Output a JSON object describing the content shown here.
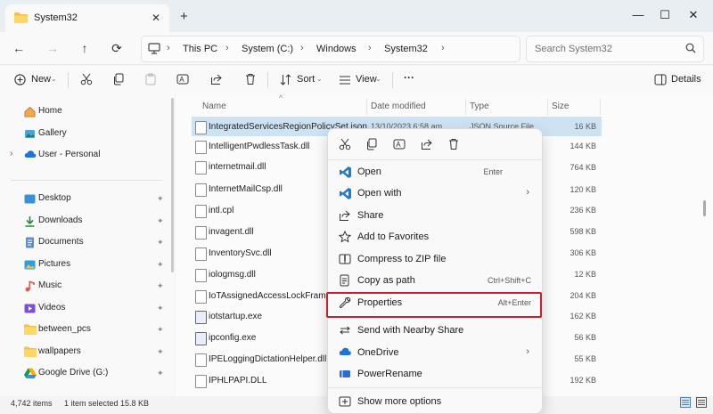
{
  "window": {
    "tab_title": "System32",
    "new_tab": "+",
    "minimize": "—",
    "maximize": "☐",
    "close": "✕"
  },
  "nav_buttons": {
    "back": "←",
    "forward": "→",
    "up": "↑",
    "refresh": "⟳"
  },
  "breadcrumb": [
    "This PC",
    "System (C:)",
    "Windows",
    "System32"
  ],
  "search": {
    "placeholder": "Search System32"
  },
  "commandbar": {
    "new_label": "New",
    "sort_label": "Sort",
    "view_label": "View",
    "more_label": "···",
    "details_label": "Details"
  },
  "sidebar": {
    "items": [
      {
        "label": "Home",
        "icon": "home-icon"
      },
      {
        "label": "Gallery",
        "icon": "gallery-icon"
      },
      {
        "label": "User - Personal",
        "icon": "cloud-icon"
      },
      {
        "label": "Desktop",
        "icon": "desktop-icon"
      },
      {
        "label": "Downloads",
        "icon": "download-icon"
      },
      {
        "label": "Documents",
        "icon": "documents-icon"
      },
      {
        "label": "Pictures",
        "icon": "pictures-icon"
      },
      {
        "label": "Music",
        "icon": "music-icon"
      },
      {
        "label": "Videos",
        "icon": "videos-icon"
      },
      {
        "label": "between_pcs",
        "icon": "folder-icon"
      },
      {
        "label": "wallpapers",
        "icon": "folder-icon"
      },
      {
        "label": "Google Drive (G:)",
        "icon": "drive-icon"
      }
    ]
  },
  "columns": {
    "name": "Name",
    "date": "Date modified",
    "type": "Type",
    "size": "Size"
  },
  "selected_row": {
    "date": "13/10/2023 6:58 am",
    "type": "JSON Source File"
  },
  "files": [
    {
      "name": "IntegratedServicesRegionPolicySet.json",
      "size": "16 KB"
    },
    {
      "name": "IntelligentPwdlessTask.dll",
      "size": "144 KB"
    },
    {
      "name": "internetmail.dll",
      "size": "764 KB"
    },
    {
      "name": "InternetMailCsp.dll",
      "size": "120 KB"
    },
    {
      "name": "intl.cpl",
      "size": "236 KB"
    },
    {
      "name": "invagent.dll",
      "size": "598 KB"
    },
    {
      "name": "InventorySvc.dll",
      "size": "306 KB"
    },
    {
      "name": "iologmsg.dll",
      "size": "12 KB"
    },
    {
      "name": "IoTAssignedAccessLockFramework",
      "size": "204 KB"
    },
    {
      "name": "iotstartup.exe",
      "size": "162 KB"
    },
    {
      "name": "ipconfig.exe",
      "size": "56 KB"
    },
    {
      "name": "IPELoggingDictationHelper.dll",
      "size": "55 KB"
    },
    {
      "name": "IPHLPAPI.DLL",
      "size": "192 KB"
    }
  ],
  "status": {
    "count": "4,742 items",
    "selected": "1 item selected  15.8 KB"
  },
  "context_menu": {
    "items": [
      {
        "label": "Open",
        "shortcut": "Enter"
      },
      {
        "label": "Open with",
        "shortcut": "›"
      },
      {
        "label": "Share",
        "shortcut": ""
      },
      {
        "label": "Add to Favorites",
        "shortcut": ""
      },
      {
        "label": "Compress to ZIP file",
        "shortcut": ""
      },
      {
        "label": "Copy as path",
        "shortcut": "Ctrl+Shift+C"
      },
      {
        "label": "Properties",
        "shortcut": "Alt+Enter"
      },
      {
        "label": "Send with Nearby Share",
        "shortcut": ""
      },
      {
        "label": "OneDrive",
        "shortcut": "›"
      },
      {
        "label": "PowerRename",
        "shortcut": ""
      },
      {
        "label": "Show more options",
        "shortcut": ""
      }
    ],
    "highlight_color": "#c8202f"
  }
}
